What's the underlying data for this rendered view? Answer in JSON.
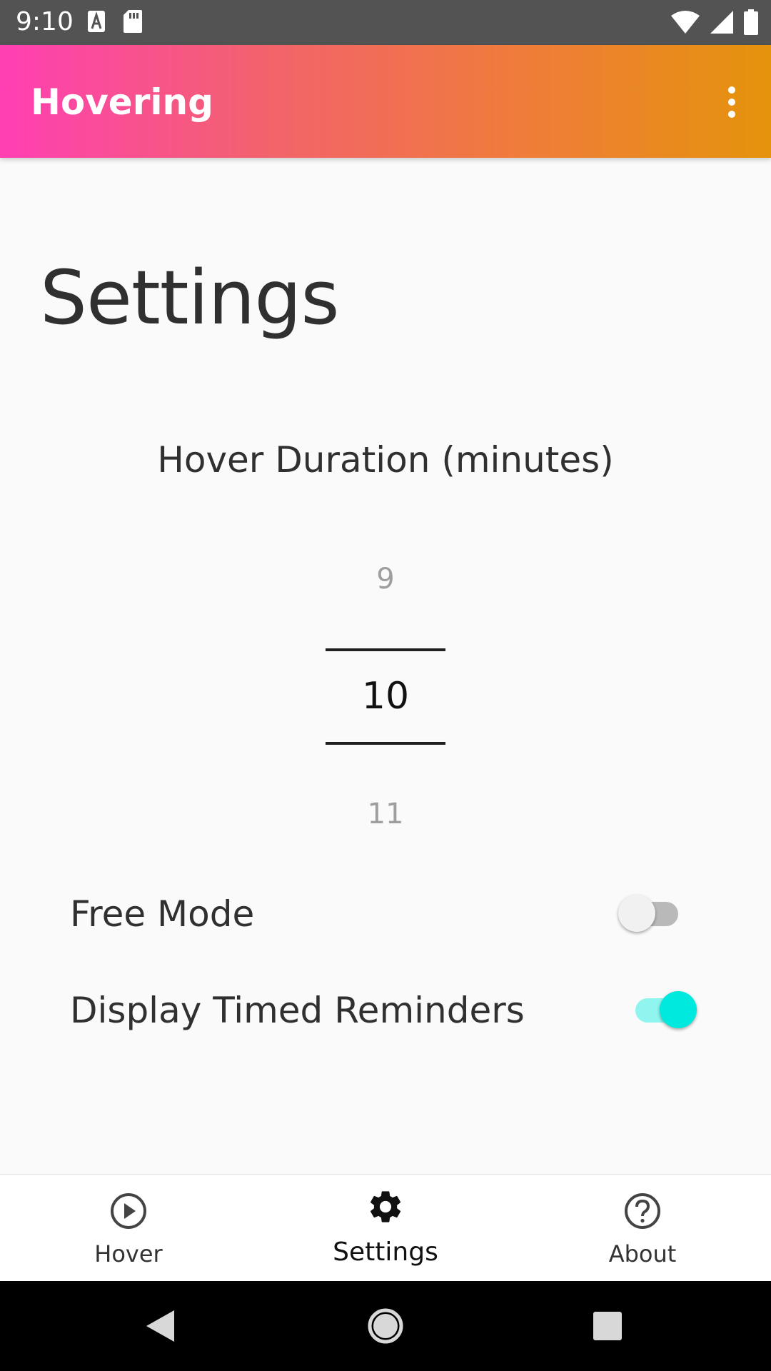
{
  "status_bar": {
    "time": "9:10",
    "left_icons": [
      "font-download-icon",
      "sd-card-icon"
    ],
    "right_icons": [
      "wifi-icon",
      "cell-signal-icon",
      "battery-icon"
    ]
  },
  "app_bar": {
    "title": "Hovering",
    "menu_icon": "more-vert-icon",
    "gradient": [
      "#ff3fb4",
      "#f2636b",
      "#f07a3e",
      "#e5930c"
    ]
  },
  "page": {
    "title": "Settings",
    "duration_label": "Hover Duration (minutes)",
    "picker": {
      "previous": "9",
      "current": "10",
      "next": "11"
    },
    "settings": [
      {
        "label": "Free Mode",
        "enabled": false
      },
      {
        "label": "Display Timed Reminders",
        "enabled": true
      }
    ]
  },
  "bottom_nav": {
    "items": [
      {
        "label": "Hover",
        "icon": "play-circle-icon",
        "active": false
      },
      {
        "label": "Settings",
        "icon": "gear-icon",
        "active": true
      },
      {
        "label": "About",
        "icon": "help-circle-icon",
        "active": false
      }
    ]
  },
  "system_nav": {
    "buttons": [
      "back-icon",
      "home-icon",
      "recents-icon"
    ]
  },
  "colors": {
    "accent": "#00e9de",
    "accent_track": "#8ff5ee",
    "background": "#fafafa",
    "status_bar": "#535353"
  }
}
